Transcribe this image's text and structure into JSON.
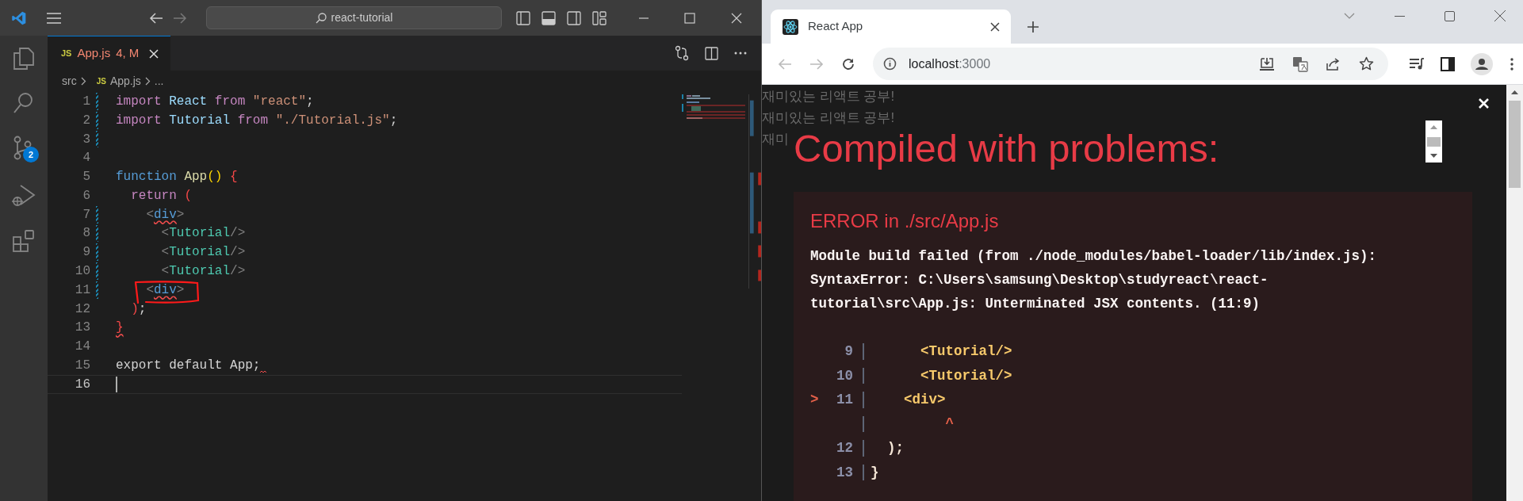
{
  "vscode": {
    "command_center": "react-tutorial",
    "activity_bar": {
      "source_control_badge": "2"
    },
    "editor_tab": {
      "file_badge": "JS",
      "filename": "App.js",
      "status": "4, M",
      "selected": true
    },
    "breadcrumbs": {
      "folder": "src",
      "file_badge": "JS",
      "file": "App.js",
      "more": "..."
    },
    "code_lines": [
      {
        "number": "1",
        "modified": true,
        "current": false,
        "trailing_squiggle": false,
        "tokens": [
          {
            "kind": "keyword",
            "text": "import",
            "squiggle": false
          },
          {
            "kind": "variable",
            "text": " React",
            "squiggle": false
          },
          {
            "kind": "keyword",
            "text": " from",
            "squiggle": false
          },
          {
            "kind": "string",
            "text": " \"react\"",
            "squiggle": false
          },
          {
            "kind": "plain",
            "text": ";",
            "squiggle": false
          }
        ]
      },
      {
        "number": "2",
        "modified": true,
        "current": false,
        "trailing_squiggle": false,
        "tokens": [
          {
            "kind": "keyword",
            "text": "import",
            "squiggle": false
          },
          {
            "kind": "variable",
            "text": " Tutorial",
            "squiggle": false
          },
          {
            "kind": "keyword",
            "text": " from",
            "squiggle": false
          },
          {
            "kind": "string",
            "text": " \"./Tutorial.js\"",
            "squiggle": false
          },
          {
            "kind": "plain",
            "text": ";",
            "squiggle": false
          }
        ]
      },
      {
        "number": "3",
        "modified": true,
        "current": false,
        "trailing_squiggle": false
      },
      {
        "number": "4",
        "modified": false,
        "current": false,
        "trailing_squiggle": false
      },
      {
        "number": "5",
        "modified": false,
        "current": false,
        "trailing_squiggle": false,
        "tokens": [
          {
            "kind": "storage",
            "text": "function",
            "squiggle": false
          },
          {
            "kind": "function",
            "text": " App",
            "squiggle": false
          },
          {
            "kind": "bracket",
            "text": "()",
            "squiggle": false
          },
          {
            "kind": "bracket_error",
            "text": " {",
            "squiggle": false
          }
        ]
      },
      {
        "number": "6",
        "modified": false,
        "current": false,
        "trailing_squiggle": false,
        "tokens": [
          {
            "kind": "keyword",
            "text": "  return",
            "squiggle": false
          },
          {
            "kind": "bracket_error",
            "text": " (",
            "squiggle": false
          }
        ]
      },
      {
        "number": "7",
        "modified": true,
        "current": false,
        "trailing_squiggle": false,
        "tokens": [
          {
            "kind": "tag_punct",
            "text": "    <",
            "squiggle": false
          },
          {
            "kind": "tag",
            "text": "div",
            "squiggle": true
          },
          {
            "kind": "tag_punct",
            "text": ">",
            "squiggle": false
          }
        ]
      },
      {
        "number": "8",
        "modified": true,
        "current": false,
        "trailing_squiggle": false,
        "tokens": [
          {
            "kind": "tag_punct",
            "text": "      <",
            "squiggle": false
          },
          {
            "kind": "component",
            "text": "Tutorial",
            "squiggle": false
          },
          {
            "kind": "tag_punct",
            "text": "/>",
            "squiggle": false
          }
        ]
      },
      {
        "number": "9",
        "modified": true,
        "current": false,
        "trailing_squiggle": false,
        "tokens": [
          {
            "kind": "tag_punct",
            "text": "      <",
            "squiggle": false
          },
          {
            "kind": "component",
            "text": "Tutorial",
            "squiggle": false
          },
          {
            "kind": "tag_punct",
            "text": "/>",
            "squiggle": false
          }
        ]
      },
      {
        "number": "10",
        "modified": true,
        "current": false,
        "trailing_squiggle": false,
        "tokens": [
          {
            "kind": "tag_punct",
            "text": "      <",
            "squiggle": false
          },
          {
            "kind": "component",
            "text": "Tutorial",
            "squiggle": false
          },
          {
            "kind": "tag_punct",
            "text": "/>",
            "squiggle": false
          }
        ]
      },
      {
        "number": "11",
        "modified": true,
        "current": false,
        "trailing_squiggle": false,
        "tokens": [
          {
            "kind": "tag_punct",
            "text": "    <",
            "squiggle": false
          },
          {
            "kind": "tag",
            "text": "div",
            "squiggle": true
          },
          {
            "kind": "tag_punct",
            "text": ">",
            "squiggle": false
          }
        ]
      },
      {
        "number": "12",
        "modified": false,
        "current": false,
        "trailing_squiggle": false,
        "tokens": [
          {
            "kind": "bracket_error",
            "text": "  )",
            "squiggle": false
          },
          {
            "kind": "plain",
            "text": ";",
            "squiggle": false
          }
        ]
      },
      {
        "number": "13",
        "modified": false,
        "current": false,
        "trailing_squiggle": false,
        "tokens": [
          {
            "kind": "bracket_error",
            "text": "}",
            "squiggle": true
          }
        ]
      },
      {
        "number": "14",
        "modified": false,
        "current": false,
        "trailing_squiggle": false
      },
      {
        "number": "15",
        "modified": false,
        "current": false,
        "trailing_squiggle": true,
        "tokens": [
          {
            "kind": "plain",
            "text": "export default App;",
            "squiggle": false
          }
        ]
      },
      {
        "number": "16",
        "modified": false,
        "current": true,
        "trailing_squiggle": false
      }
    ]
  },
  "browser": {
    "tab": {
      "title": "React App",
      "selected": true
    },
    "address": {
      "host": "localhost",
      "port": ":3000"
    },
    "page_lines": [
      "재미있는 리액트 공부!",
      "재미있는 리액트 공부!",
      "재미"
    ],
    "overlay": {
      "title": "Compiled with problems:",
      "error_heading": "ERROR in ./src/App.js",
      "message_lines": [
        "Module build failed (from ./node_modules/babel-loader/lib/index.js):",
        "SyntaxError: C:\\Users\\samsung\\Desktop\\studyreact\\react-",
        "tutorial\\src\\App.js: Unterminated JSX contents. (11:9)"
      ],
      "frame": [
        {
          "kind": "code",
          "number": "9",
          "code": "      <Tutorial/>"
        },
        {
          "kind": "code",
          "number": "10",
          "code": "      <Tutorial/>"
        },
        {
          "kind": "code",
          "marker": ">",
          "number": "11",
          "code": "    <div>"
        },
        {
          "kind": "caret",
          "code": "         ^"
        },
        {
          "kind": "plain",
          "number": "12",
          "code": "  );"
        },
        {
          "kind": "plain",
          "number": "13",
          "code": "}"
        }
      ]
    }
  }
}
